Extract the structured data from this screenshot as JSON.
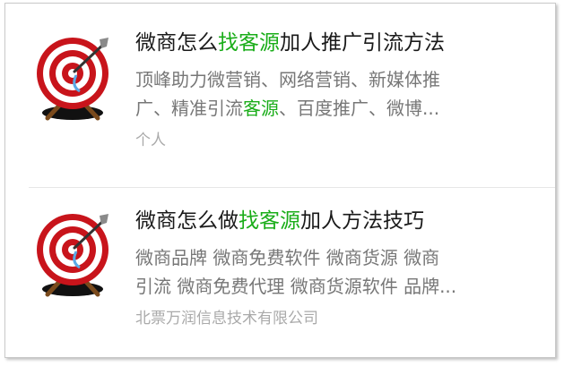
{
  "results": [
    {
      "title_pre": "微商怎么",
      "title_highlight": "找客源",
      "title_post": "加人推广引流方法",
      "desc_line1": "顶峰助力微营销、网络营销、新媒体推",
      "desc_line2_pre": "广、精准引流",
      "desc_line2_highlight": "客源",
      "desc_line2_post": "、百度推广、微博...",
      "source": "个人",
      "thumbnail_icon": "dart-target-icon"
    },
    {
      "title_pre": "微商怎么做",
      "title_highlight": "找客源",
      "title_post": "加人方法技巧",
      "desc_line1": "微商品牌 微商免费软件 微商货源 微商",
      "desc_line2": "引流 微商免费代理 微商货源软件 品牌...",
      "source": "北票万润信息技术有限公司",
      "thumbnail_icon": "dart-target-icon"
    }
  ],
  "colors": {
    "highlight": "#1aad19",
    "title": "#1a1a1a",
    "description": "#777777",
    "source": "#aaaaaa"
  }
}
